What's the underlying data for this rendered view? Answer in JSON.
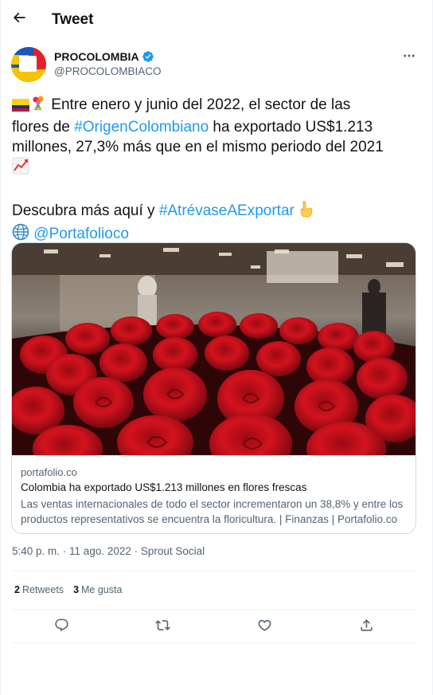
{
  "header": {
    "title": "Tweet",
    "back_icon": "arrow-left-icon"
  },
  "author": {
    "name": "PROCOLOMBIA",
    "handle": "@PROCOLOMBIACO",
    "verified": true,
    "avatar_colors": [
      "#f6c300",
      "#e2212c",
      "#1c55c0"
    ]
  },
  "tweet": {
    "flag_emoji": "🇨🇴",
    "flower_emoji": "💐",
    "text_1": " Entre enero y junio del 2022, el sector de las",
    "text_2a": "flores de ",
    "hashtag_1": "#OrigenColombiano",
    "text_2b": " ha exportado US$1.213",
    "text_3": "millones, 27,3% más que en el mismo periodo del 2021",
    "chart_emoji": "📈",
    "text_4a": "Descubra más aquí y ",
    "hashtag_2": "#AtrévaseAExportar",
    "point_emoji": "👇",
    "globe_emoji": "🌐",
    "mention": "@Portafolioco"
  },
  "card": {
    "domain": "portafolio.co",
    "title": "Colombia ha exportado US$1.213 millones en flores frescas",
    "description_1": "Las ventas internacionales de todo el sector incrementaron un 38,8% y entre los",
    "description_2": "productos representativos se encuentra la floricultura. | Finanzas | Portafolio.co"
  },
  "meta": {
    "time": "5:40 p. m.",
    "separator": " · ",
    "date": "11 ago. 2022",
    "source": "Sprout Social"
  },
  "stats": {
    "retweets_count": "2",
    "retweets_label": "Retweets",
    "likes_count": "3",
    "likes_label": "Me gusta"
  },
  "actions": [
    "reply-icon",
    "retweet-icon",
    "like-icon",
    "share-icon"
  ],
  "colors": {
    "link": "#1d9bf0",
    "text": "#0f1419",
    "secondary": "#536471",
    "border": "#cfd9de"
  }
}
